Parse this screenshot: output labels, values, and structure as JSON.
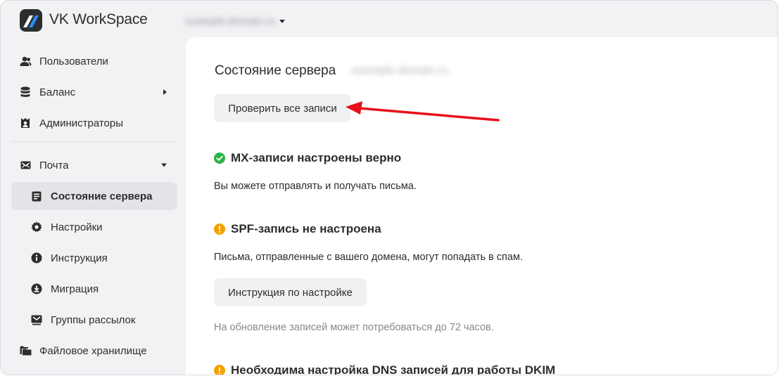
{
  "header": {
    "brand": "VK WorkSpace",
    "domain_blurred": "example-domain.ru"
  },
  "sidebar": {
    "items": [
      {
        "label": "Пользователи",
        "icon": "users-icon"
      },
      {
        "label": "Баланс",
        "icon": "database-icon"
      },
      {
        "label": "Администраторы",
        "icon": "admin-icon"
      },
      {
        "label": "Почта",
        "icon": "mail-icon"
      },
      {
        "label": "Состояние сервера",
        "icon": "server-status-icon"
      },
      {
        "label": "Настройки",
        "icon": "gear-icon"
      },
      {
        "label": "Инструкция",
        "icon": "info-icon"
      },
      {
        "label": "Миграция",
        "icon": "download-icon"
      },
      {
        "label": "Группы рассылок",
        "icon": "mailing-group-icon"
      },
      {
        "label": "Файловое хранилище",
        "icon": "folders-icon"
      }
    ]
  },
  "main": {
    "title": "Состояние сервера",
    "title_suffix_blurred": "example-domain.ru",
    "check_button": "Проверить все записи",
    "sections": [
      {
        "status": "ok",
        "title": "MX-записи настроены верно",
        "description": "Вы можете отправлять и получать письма."
      },
      {
        "status": "warning",
        "title": "SPF-запись не настроена",
        "description": "Письма, отправленные с вашего домена, могут попадать в спам.",
        "button": "Инструкция по настройке",
        "note": "На обновление записей может потребоваться до 72 часов."
      },
      {
        "status": "warning",
        "title": "Необходима настройка DNS записей для работы DKIM"
      }
    ]
  },
  "colors": {
    "ok": "#2bb34a",
    "warning": "#f5a000",
    "annotation_arrow": "#e8111b",
    "active_bg": "#e3e4e8"
  }
}
